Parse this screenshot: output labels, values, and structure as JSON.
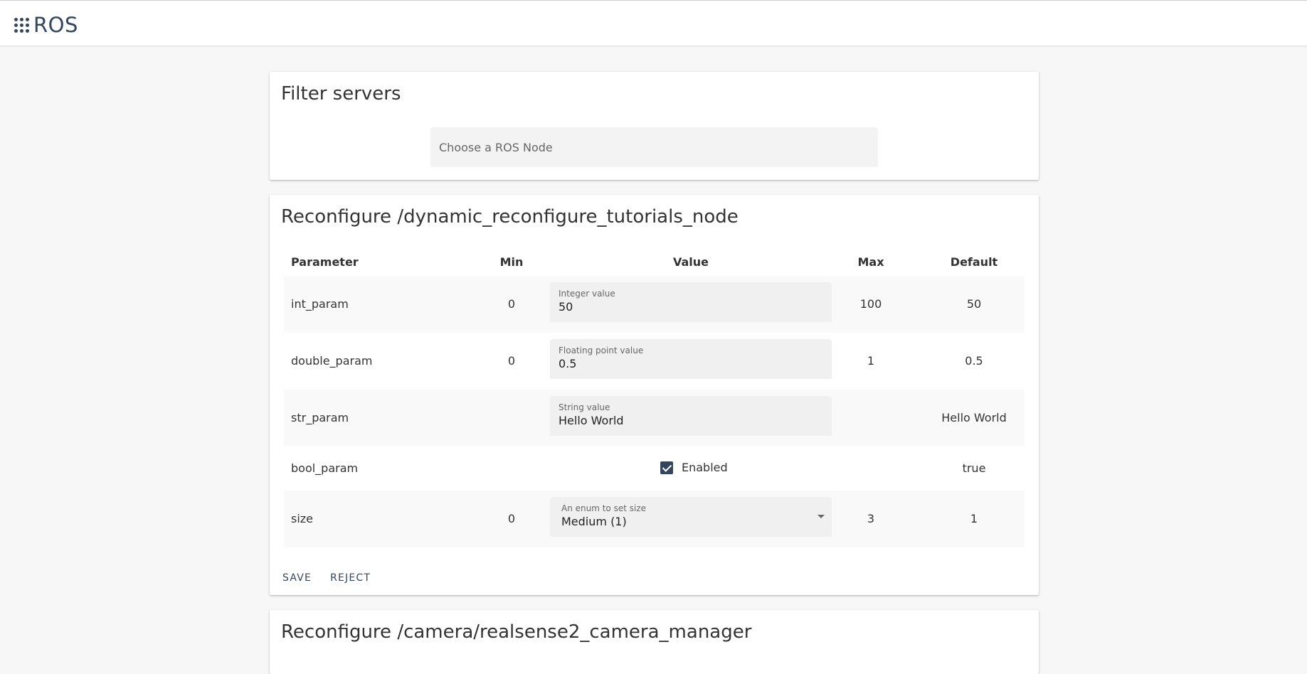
{
  "app": {
    "brand": "ROS",
    "brand_icon": "apps-grid-icon",
    "accent": "#34465e"
  },
  "filter": {
    "title": "Filter servers",
    "select_placeholder": "Choose a ROS Node"
  },
  "node_card": {
    "title": "Reconfigure /dynamic_reconfigure_tutorials_node",
    "headers": {
      "parameter": "Parameter",
      "min": "Min",
      "value": "Value",
      "max": "Max",
      "default": "Default"
    },
    "rows": [
      {
        "param": "int_param",
        "min": "0",
        "label": "Integer value",
        "value": "50",
        "max": "100",
        "default": "50"
      },
      {
        "param": "double_param",
        "min": "0",
        "label": "Floating point value",
        "value": "0.5",
        "max": "1",
        "default": "0.5"
      },
      {
        "param": "str_param",
        "min": "",
        "label": "String value",
        "value": "Hello World",
        "max": "",
        "default": "Hello World"
      },
      {
        "param": "bool_param",
        "checkbox_label": "Enabled",
        "checked": true,
        "default": "true"
      },
      {
        "param": "size",
        "min": "0",
        "label": "An enum to set size",
        "value": "Medium (1)",
        "max": "3",
        "default": "1"
      }
    ],
    "actions": {
      "save": "SAVE",
      "reject": "REJECT"
    }
  },
  "camera_card": {
    "title": "Reconfigure /camera/realsense2_camera_manager"
  }
}
